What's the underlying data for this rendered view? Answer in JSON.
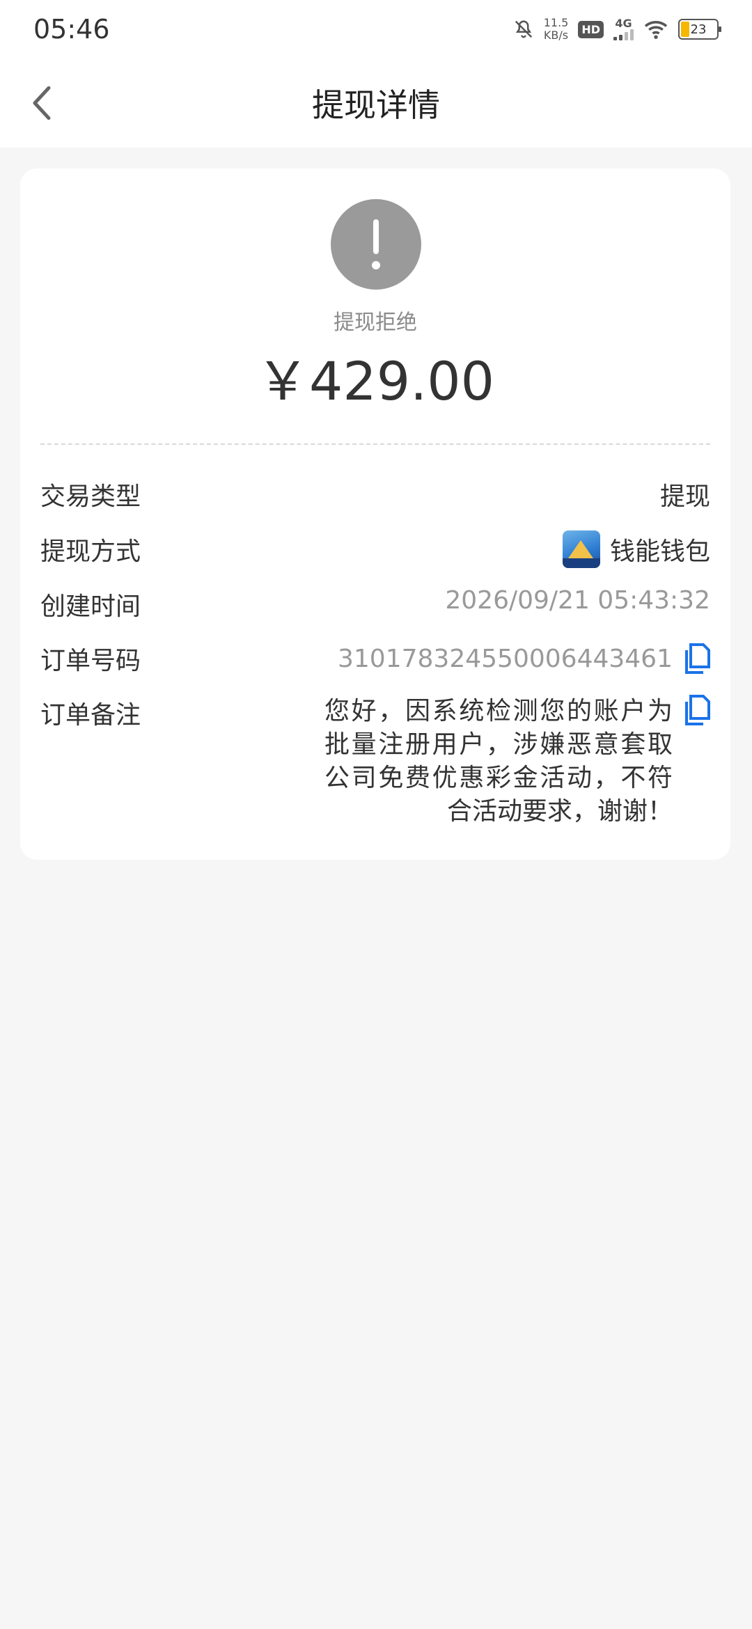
{
  "status_bar": {
    "time": "05:46",
    "speed_value": "11.5",
    "speed_unit": "KB/s",
    "hd": "HD",
    "network": "4G",
    "battery": "23"
  },
  "nav": {
    "title": "提现详情"
  },
  "summary": {
    "status": "提现拒绝",
    "amount": "￥429.00"
  },
  "details": {
    "type_label": "交易类型",
    "type_value": "提现",
    "method_label": "提现方式",
    "method_value": "钱能钱包",
    "created_label": "创建时间",
    "created_value": "2026/09/21 05:43:32",
    "order_label": "订单号码",
    "order_value": "3101783245500064434​61",
    "remark_label": "订单备注",
    "remark_value": "您好，因系统检测您的账户为批量注册用户，涉嫌恶意套取公司免费优惠彩金活动，不符合活动要求，谢谢！"
  },
  "colors": {
    "accent": "#1a73e8",
    "status_icon": "#9a9a9a",
    "background": "#f6f6f6"
  }
}
